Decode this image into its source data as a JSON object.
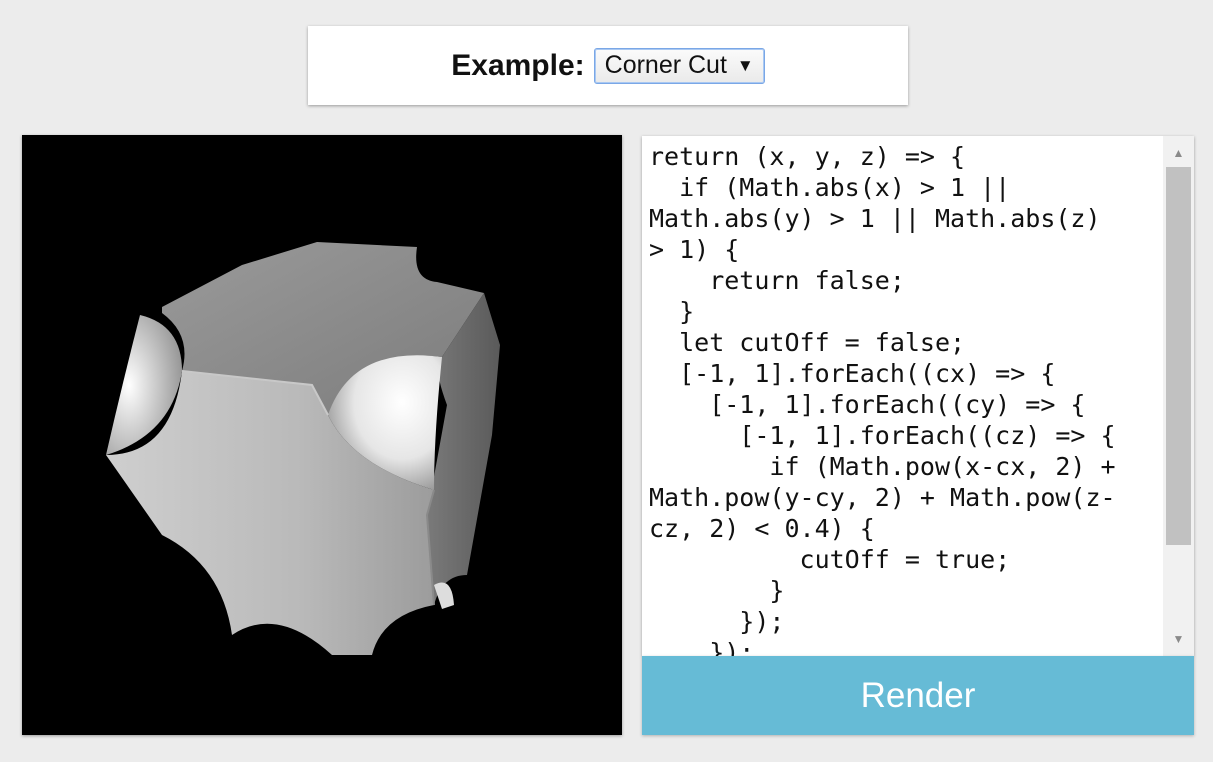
{
  "header": {
    "example_label": "Example:",
    "example_select_value": "Corner Cut",
    "select_arrow_glyph": "▼"
  },
  "editor": {
    "code": "return (x, y, z) => {\n  if (Math.abs(x) > 1 ||\nMath.abs(y) > 1 || Math.abs(z)\n> 1) {\n    return false;\n  }\n  let cutOff = false;\n  [-1, 1].forEach((cx) => {\n    [-1, 1].forEach((cy) => {\n      [-1, 1].forEach((cz) => {\n        if (Math.pow(x-cx, 2) +\nMath.pow(y-cy, 2) + Math.pow(z-\ncz, 2) < 0.4) {\n          cutOff = true;\n        }\n      });\n    });"
  },
  "render_button": {
    "label": "Render"
  },
  "colors": {
    "background": "#ececec",
    "render_button": "#66bbd6",
    "viewport": "#000000",
    "select_border": "#7aa7e6"
  }
}
